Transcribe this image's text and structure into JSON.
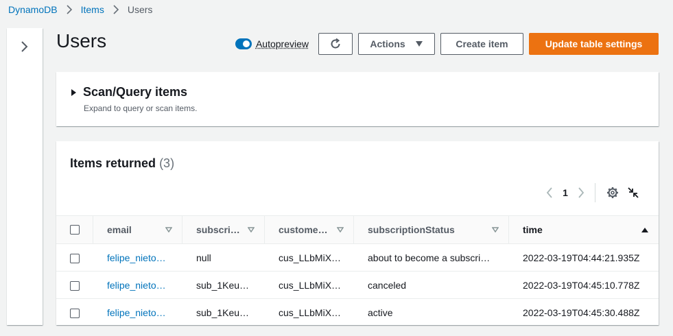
{
  "breadcrumb": {
    "items": [
      "DynamoDB",
      "Items"
    ],
    "current": "Users"
  },
  "header": {
    "title": "Users",
    "autopreview_label": "Autopreview",
    "actions_label": "Actions",
    "create_label": "Create item",
    "update_label": "Update table settings"
  },
  "scan": {
    "title": "Scan/Query items",
    "description": "Expand to query or scan items."
  },
  "items": {
    "title": "Items returned",
    "count": "(3)",
    "page": "1",
    "columns": [
      "email",
      "subscri…",
      "custome…",
      "subscriptionStatus",
      "time"
    ],
    "rows": [
      {
        "email": "felipe_nieto…",
        "subscription": "null",
        "customer": "cus_LLbMiX…",
        "status": "about to become a subscri…",
        "time": "2022-03-19T04:44:21.935Z"
      },
      {
        "email": "felipe_nieto…",
        "subscription": "sub_1Keu…",
        "customer": "cus_LLbMiX…",
        "status": "canceled",
        "time": "2022-03-19T04:45:10.778Z"
      },
      {
        "email": "felipe_nieto…",
        "subscription": "sub_1Keu…",
        "customer": "cus_LLbMiX…",
        "status": "active",
        "time": "2022-03-19T04:45:30.488Z"
      }
    ]
  },
  "colors": {
    "link": "#0073bb",
    "primary": "#ec7211",
    "toggle": "#0073bb"
  }
}
